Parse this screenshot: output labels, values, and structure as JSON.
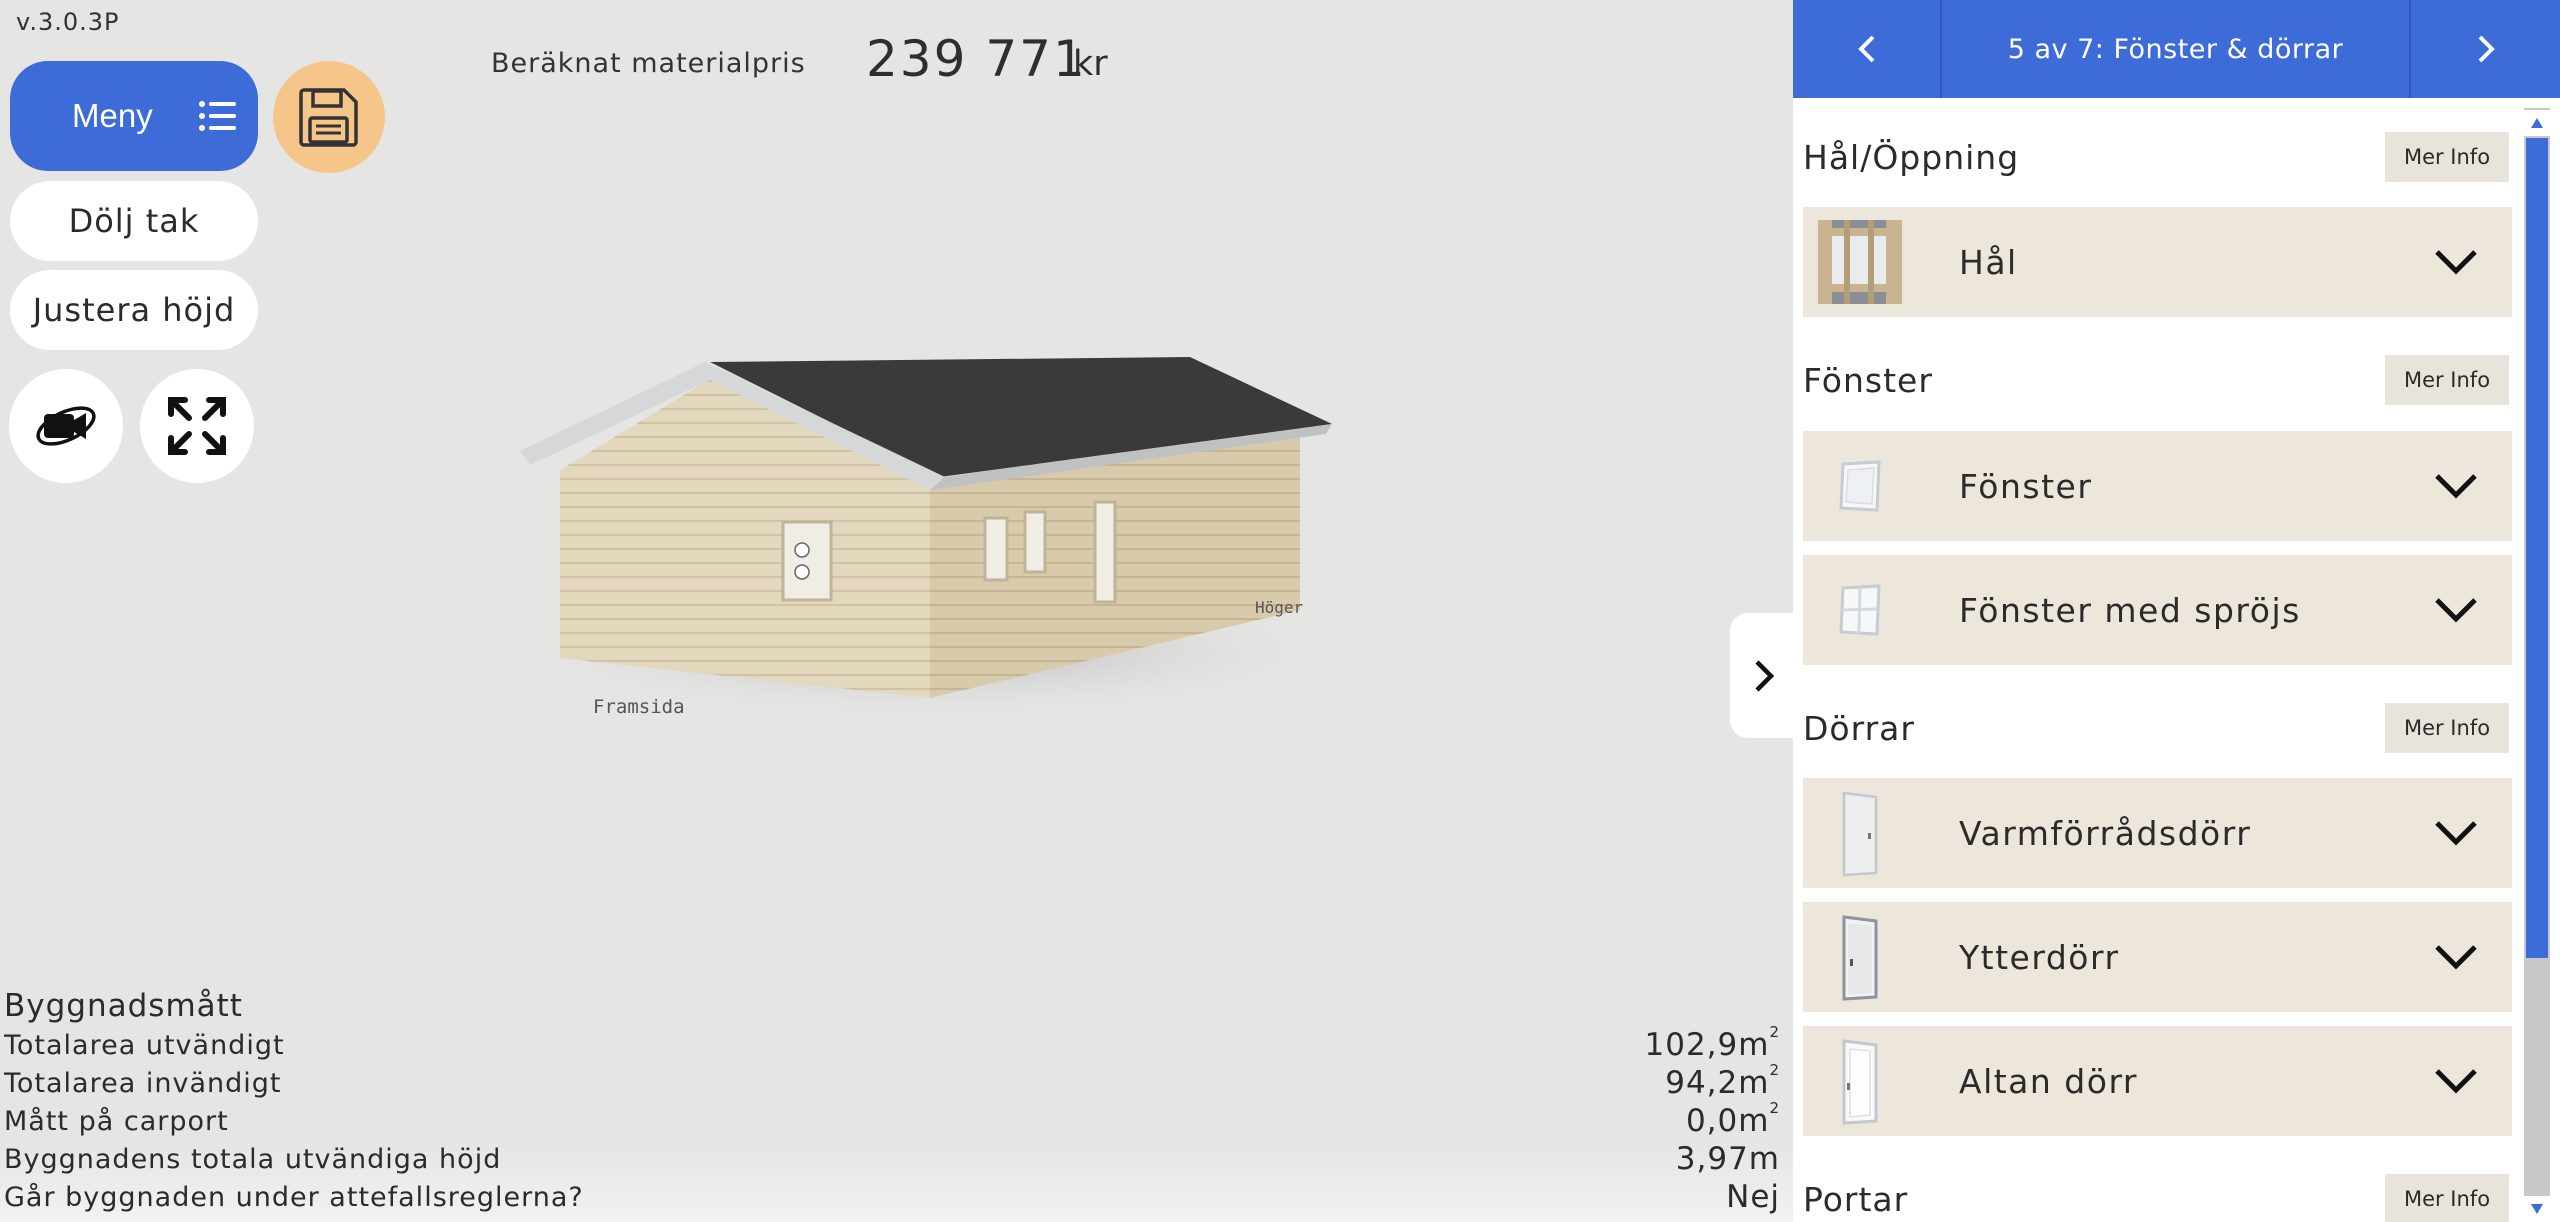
{
  "app": {
    "version": "v.3.0.3P"
  },
  "toolbar": {
    "menu_label": "Meny",
    "hide_roof_label": "Dölj tak",
    "adjust_height_label": "Justera höjd"
  },
  "price": {
    "label": "Beräknat materialpris",
    "value": "239 771",
    "unit": "kr"
  },
  "scene": {
    "front_label": "Framsida",
    "right_label": "Höger"
  },
  "dimensions": {
    "title": "Byggnadsmått",
    "rows": [
      {
        "label": "Totalarea utvändigt",
        "value": "102,9m",
        "sup": "2"
      },
      {
        "label": "Totalarea invändigt",
        "value": "94,2m",
        "sup": "2"
      },
      {
        "label": "Mått på carport",
        "value": "0,0m",
        "sup": "2"
      },
      {
        "label": "Byggnadens totala utvändiga höjd",
        "value": "3,97m",
        "sup": ""
      },
      {
        "label": "Går byggnaden under attefallsreglerna?",
        "value": "Nej",
        "sup": ""
      }
    ]
  },
  "panel": {
    "step_title": "5 av 7: Fönster & dörrar",
    "more_info_label": "Mer Info",
    "sections": [
      {
        "name": "Hål/Öppning",
        "items": [
          {
            "name": "Hål",
            "icon": "hole-thumbnail"
          }
        ]
      },
      {
        "name": "Fönster",
        "items": [
          {
            "name": "Fönster",
            "icon": "window-thumbnail"
          },
          {
            "name": "Fönster med spröjs",
            "icon": "mullion-window-thumbnail"
          }
        ]
      },
      {
        "name": "Dörrar",
        "items": [
          {
            "name": "Varmförrådsdörr",
            "icon": "storage-door-thumbnail"
          },
          {
            "name": "Ytterdörr",
            "icon": "exterior-door-thumbnail"
          },
          {
            "name": "Altan dörr",
            "icon": "patio-door-thumbnail"
          }
        ]
      },
      {
        "name": "Portar",
        "items": []
      }
    ]
  },
  "colors": {
    "accent": "#3d6bd8",
    "save": "#f5c58a",
    "item_bg": "#ede6da",
    "viewport_bg": "#e5e5e4"
  }
}
